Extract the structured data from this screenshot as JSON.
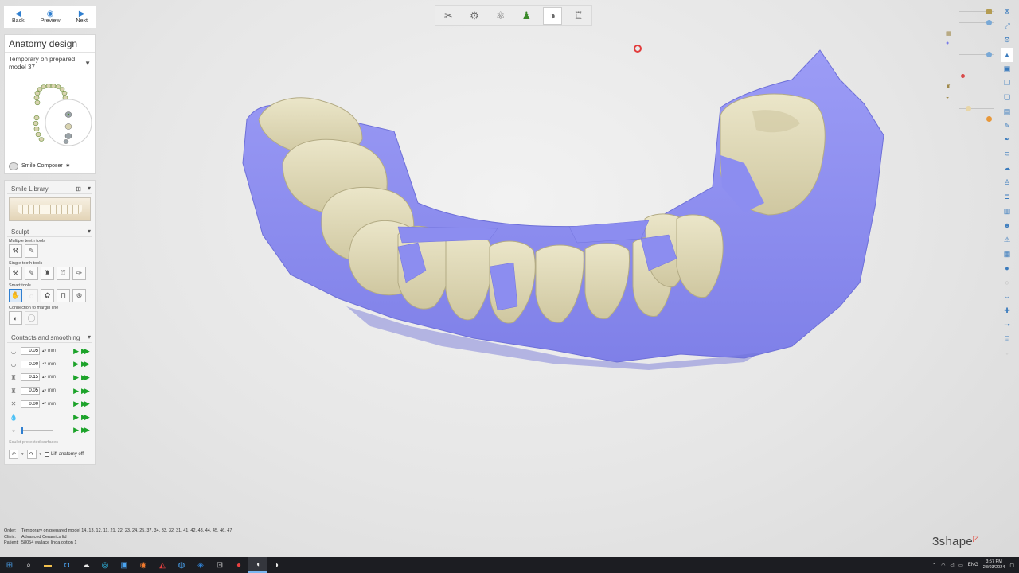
{
  "nav": {
    "back": "Back",
    "preview": "Preview",
    "next": "Next"
  },
  "panel": {
    "title": "Anatomy design",
    "order_select": "Temporary on prepared model 37",
    "smile_composer": "Smile Composer"
  },
  "smile_library": {
    "label": "Smile Library"
  },
  "sculpt": {
    "label": "Sculpt",
    "multiple_label": "Multiple teeth tools",
    "single_label": "Single tooth tools",
    "smart_label": "Smart tools",
    "margin_label": "Connection to margin line"
  },
  "contacts": {
    "label": "Contacts and smoothing",
    "rows": [
      {
        "value": "0.05",
        "unit": "mm"
      },
      {
        "value": "0.00",
        "unit": "mm"
      },
      {
        "value": "0.15",
        "unit": "mm"
      },
      {
        "value": "0.05",
        "unit": "mm"
      },
      {
        "value": "0.00",
        "unit": "mm"
      }
    ],
    "protected": "Sculpt protected surfaces",
    "lift_anatomy": "Lift anatomy off"
  },
  "info": {
    "order_key": "Order:",
    "order": "Temporary on prepared model 14, 13, 12, 11, 21, 22, 23, 24, 25, 37, 34, 33, 32, 31, 41, 42, 43, 44, 45, 46, 47",
    "clinic_key": "Clinic:",
    "clinic": "Advanced Ceramics ltd",
    "patient_key": "Patient:",
    "patient": "58054 wallace linda option 1"
  },
  "logo": "3shape",
  "taskbar": {
    "lang": "ENG",
    "time": "3:57 PM",
    "date": "28/03/2024"
  },
  "colors": {
    "tooth": "#dcd6b4",
    "gum": "#8e8ff2",
    "accent": "#2f7fd0",
    "play": "#1ca32a"
  },
  "icons": {
    "toolbar": [
      "knife-icon",
      "prep-icon",
      "jaw-icon",
      "die-icon",
      "tooth-icon",
      "crown-icon"
    ]
  }
}
